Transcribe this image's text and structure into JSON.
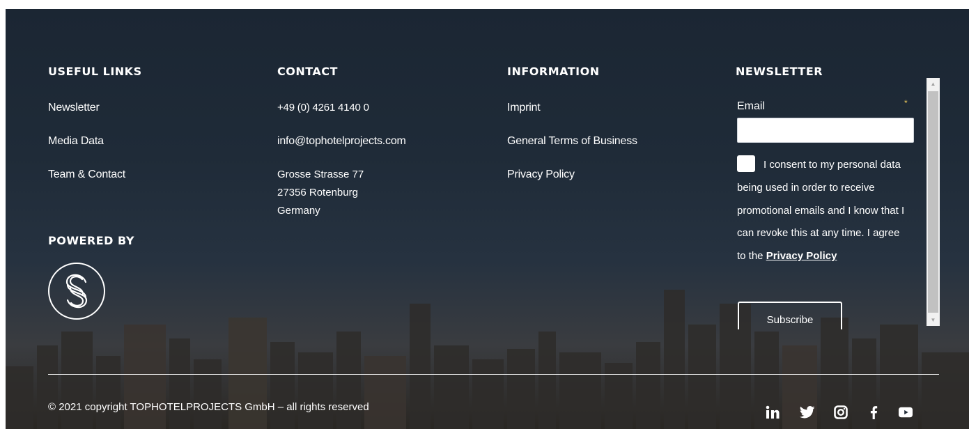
{
  "useful_links": {
    "title": "USEFUL LINKS",
    "items": [
      "Newsletter",
      "Media Data",
      "Team & Contact"
    ]
  },
  "powered_by": {
    "title": "POWERED BY"
  },
  "contact": {
    "title": "CONTACT",
    "phone": "+49 (0) 4261 4140 0",
    "email": "info@tophotelprojects.com",
    "address": [
      "Grosse Strasse 77",
      "27356 Rotenburg",
      "Germany"
    ]
  },
  "information": {
    "title": "INFORMATION",
    "items": [
      "Imprint",
      "General Terms of Business",
      "Privacy Policy"
    ]
  },
  "newsletter": {
    "title": "NEWSLETTER",
    "email_label": "Email",
    "required_marker": "*",
    "email_value": "",
    "consent_text": "I consent to my personal data being used in order to receive promotional emails and I know that I can revoke this at any time. I agree to the",
    "consent_link": "Privacy Policy",
    "subscribe_label": "Subscribe"
  },
  "copyright": "© 2021 copyright TOPHOTELPROJECTS GmbH – all rights reserved",
  "social_icons": [
    "linkedin-icon",
    "twitter-icon",
    "instagram-icon",
    "facebook-icon",
    "youtube-icon"
  ],
  "colors": {
    "text": "#ffffff",
    "required_marker": "#e8c55a",
    "background": "#1f2b38"
  }
}
